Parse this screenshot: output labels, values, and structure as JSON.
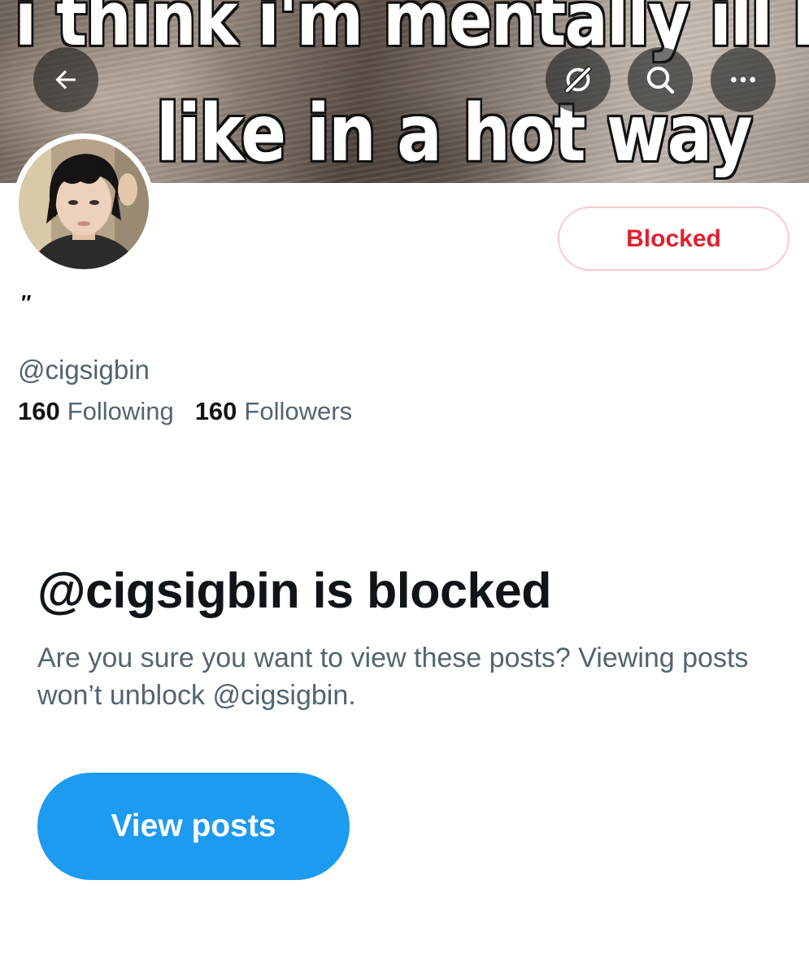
{
  "banner": {
    "line1": "i think i'm mentally ill but",
    "line2": "like in a hot way"
  },
  "header": {
    "back_icon": "arrow-left-icon",
    "grok_icon": "grok-icon",
    "search_icon": "search-icon",
    "more_icon": "more-horizontal-icon"
  },
  "profile": {
    "display_name": "″",
    "handle": "@cigsigbin",
    "following_count": "160",
    "following_label": "Following",
    "followers_count": "160",
    "followers_label": "Followers",
    "blocked_button_label": "Blocked"
  },
  "blocked_notice": {
    "title": "@cigsigbin is blocked",
    "description": "Are you sure you want to view these posts? Viewing posts won’t unblock @cigsigbin.",
    "view_posts_label": "View posts"
  },
  "colors": {
    "accent": "#1d9bf0",
    "blocked_red": "#e02030",
    "secondary_text": "#536471",
    "primary_text": "#0f1419"
  }
}
